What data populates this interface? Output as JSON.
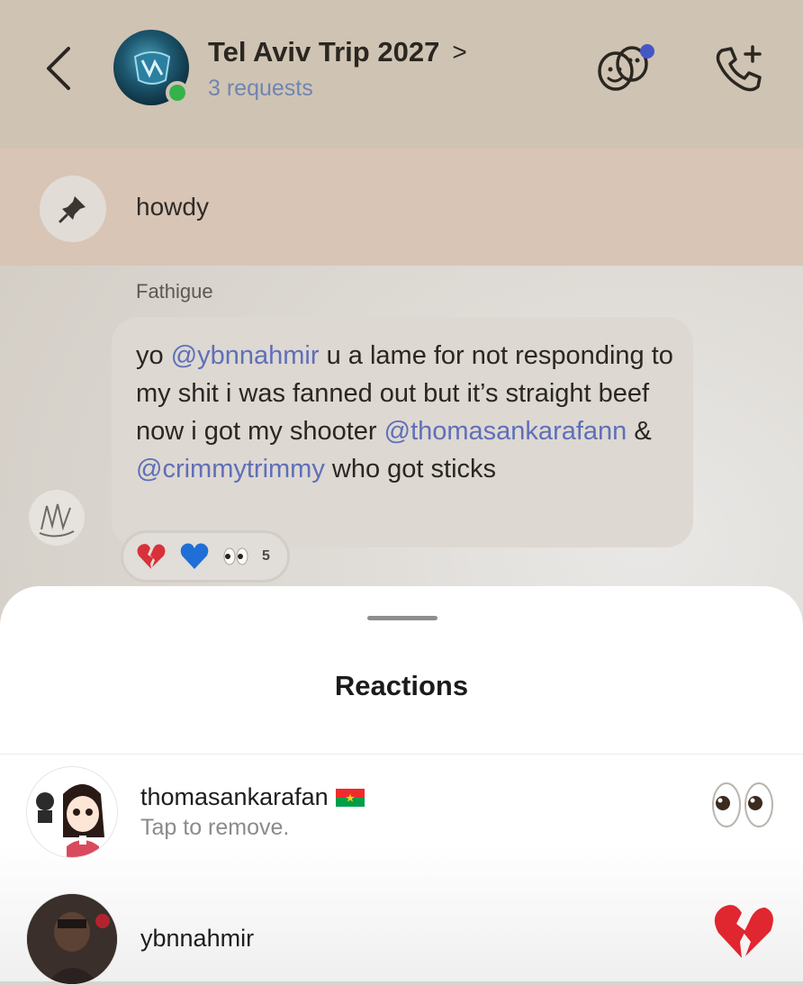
{
  "header": {
    "title": "Tel Aviv Trip 2027",
    "title_chevron": ">",
    "subtitle": "3 requests",
    "back_icon": "chevron-left-icon",
    "effects_icon": "smiley-effects-icon",
    "call_icon": "add-call-icon",
    "colors": {
      "subtitle": "#6f85b2",
      "online": "#36b24a",
      "effects_badge": "#4556c6"
    }
  },
  "pinned": {
    "text": "howdy",
    "icon": "pin-icon"
  },
  "message": {
    "sender": "Fathigue",
    "segments": {
      "s1": "yo ",
      "m1": "@ybnnahmir",
      "s2": " u a lame for not responding to my shit i was fanned out but it’s straight beef now i got my shooter ",
      "m2": "@thomasankarafann",
      "s3": " & ",
      "m3": "@crimmytrimmy",
      "s4": " who got sticks"
    },
    "reactions_summary": {
      "icons": [
        "broken-heart-icon",
        "blue-heart-icon",
        "eyes-icon"
      ],
      "count": "5"
    },
    "mention_color": "#5f6fb8"
  },
  "sheet": {
    "title": "Reactions",
    "rows": [
      {
        "username": "thomasankarafan",
        "flag_icon": "burkina-faso-flag-icon",
        "subtitle": "Tap to remove.",
        "reaction_icon": "eyes-icon"
      },
      {
        "username": "ybnnahmir",
        "reaction_icon": "broken-heart-icon"
      }
    ]
  }
}
